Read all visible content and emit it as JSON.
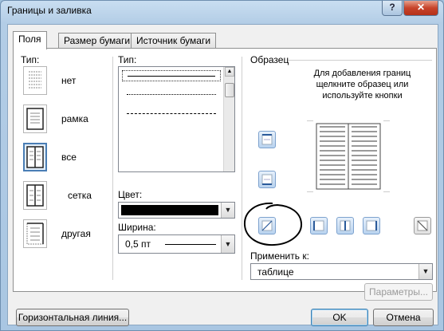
{
  "window": {
    "title": "Границы и заливка",
    "help_label": "?",
    "close_label": "✕"
  },
  "tabs": [
    {
      "label": "Поля",
      "active": true
    },
    {
      "label": "Размер бумаги",
      "active": false
    },
    {
      "label": "Источник бумаги",
      "active": false
    }
  ],
  "setting": {
    "header": "Тип:",
    "items": [
      {
        "label": "нет",
        "selected": false
      },
      {
        "label": "рамка",
        "selected": false
      },
      {
        "label": "все",
        "selected": true
      },
      {
        "label": "сетка",
        "selected": false
      },
      {
        "label": "другая",
        "selected": false
      }
    ]
  },
  "style": {
    "header": "Тип:",
    "line_styles": [
      "solid",
      "dotted",
      "dashed-small",
      "dashed",
      "dash-dot",
      "dash-dot-dot"
    ]
  },
  "color": {
    "label": "Цвет:",
    "value_color": "#000000"
  },
  "width": {
    "label": "Ширина:",
    "value": "0,5 пт"
  },
  "preview": {
    "header": "Образец",
    "hint": "Для добавления границ щелкните образец или используйте кнопки"
  },
  "apply_to": {
    "label": "Применить к:",
    "value": "таблице"
  },
  "buttons": {
    "options": "Параметры...",
    "horizontal_line": "Горизонтальная линия...",
    "ok": "OK",
    "cancel": "Отмена"
  },
  "colors": {
    "accent": "#4a7eb5",
    "annotation": "#000000"
  }
}
